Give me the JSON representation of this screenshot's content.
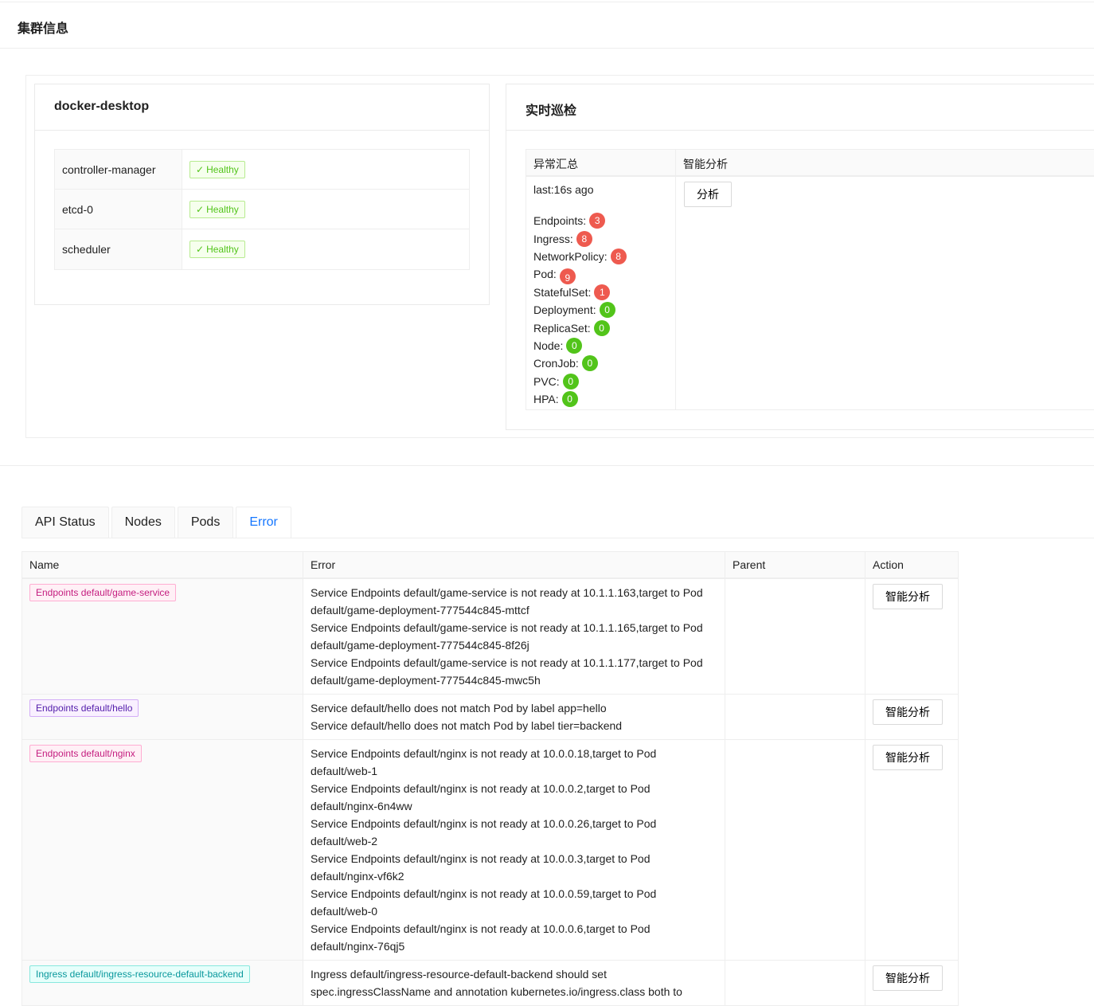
{
  "header": {
    "title": "集群信息"
  },
  "cluster": {
    "name": "docker-desktop",
    "components": [
      {
        "name": "controller-manager",
        "status": "Healthy"
      },
      {
        "name": "etcd-0",
        "status": "Healthy"
      },
      {
        "name": "scheduler",
        "status": "Healthy"
      }
    ]
  },
  "inspection": {
    "title": "实时巡检",
    "col_summary": "异常汇总",
    "col_analysis": "智能分析",
    "last": "last:16s ago",
    "analyze_button": "分析",
    "resources": [
      {
        "label": "Endpoints:",
        "count": "3",
        "color": "#ee5a4f"
      },
      {
        "label": "Ingress:",
        "count": "8",
        "color": "#ee5a4f"
      },
      {
        "label": "NetworkPolicy:",
        "count": "8",
        "color": "#ee5a4f"
      },
      {
        "label": "Pod:",
        "count": "9",
        "color": "#ee5a4f"
      },
      {
        "label": "StatefulSet:",
        "count": "1",
        "color": "#ee5a4f"
      },
      {
        "label": "Deployment:",
        "count": "0",
        "color": "#52c41a"
      },
      {
        "label": "ReplicaSet:",
        "count": "0",
        "color": "#52c41a"
      },
      {
        "label": "Node:",
        "count": "0",
        "color": "#52c41a"
      },
      {
        "label": "CronJob:",
        "count": "0",
        "color": "#52c41a"
      },
      {
        "label": "PVC:",
        "count": "0",
        "color": "#52c41a"
      },
      {
        "label": "HPA:",
        "count": "0",
        "color": "#52c41a"
      }
    ]
  },
  "tabs": [
    "API Status",
    "Nodes",
    "Pods",
    "Error"
  ],
  "active_tab": "Error",
  "error_table": {
    "columns": [
      "Name",
      "Error",
      "Parent",
      "Action"
    ],
    "action_label": "智能分析",
    "rows": [
      {
        "name": "Endpoints default/game-service",
        "tag": "magenta",
        "errors": [
          "Service Endpoints default/game-service is not ready at 10.1.1.163,target to Pod default/game-deployment-777544c845-mttcf",
          "Service Endpoints default/game-service is not ready at 10.1.1.165,target to Pod default/game-deployment-777544c845-8f26j",
          "Service Endpoints default/game-service is not ready at 10.1.1.177,target to Pod default/game-deployment-777544c845-mwc5h"
        ],
        "parent": ""
      },
      {
        "name": "Endpoints default/hello",
        "tag": "purple",
        "errors": [
          "Service default/hello does not match Pod by label app=hello",
          "Service default/hello does not match Pod by label tier=backend"
        ],
        "parent": ""
      },
      {
        "name": "Endpoints default/nginx",
        "tag": "pink",
        "errors": [
          "Service Endpoints default/nginx is not ready at 10.0.0.18,target to Pod default/web-1",
          "Service Endpoints default/nginx is not ready at 10.0.0.2,target to Pod default/nginx-6n4ww",
          "Service Endpoints default/nginx is not ready at 10.0.0.26,target to Pod default/web-2",
          "Service Endpoints default/nginx is not ready at 10.0.0.3,target to Pod default/nginx-vf6k2",
          "Service Endpoints default/nginx is not ready at 10.0.0.59,target to Pod default/web-0",
          "Service Endpoints default/nginx is not ready at 10.0.0.6,target to Pod default/nginx-76qj5"
        ],
        "parent": ""
      },
      {
        "name": "Ingress default/ingress-resource-default-backend",
        "tag": "cyan",
        "errors": [
          "Ingress default/ingress-resource-default-backend should set spec.ingressClassName and annotation kubernetes.io/ingress.class both to"
        ],
        "parent": ""
      }
    ]
  }
}
